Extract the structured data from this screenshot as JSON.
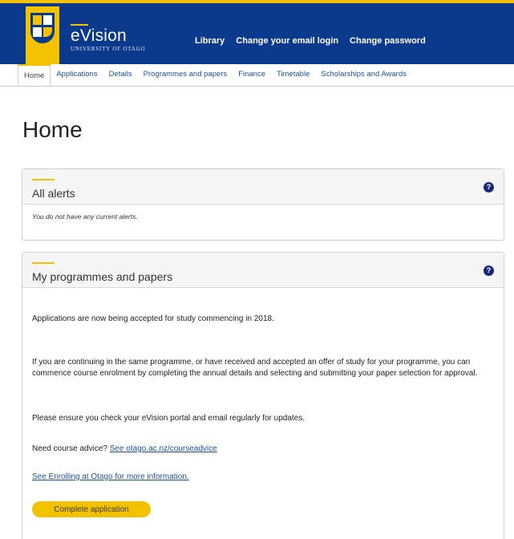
{
  "header": {
    "brand_name": "eVision",
    "brand_sub": "UNIVERSITY OF OTAGO",
    "links": [
      "Library",
      "Change your email login",
      "Change password"
    ]
  },
  "tabs": [
    "Home",
    "Applications",
    "Details",
    "Programmes and papers",
    "Finance",
    "Timetable",
    "Scholarships and Awards"
  ],
  "active_tab": "Home",
  "page_title": "Home",
  "alerts_panel": {
    "title": "All alerts",
    "message": "You do not have any current alerts."
  },
  "programmes_panel": {
    "title": "My programmes and papers",
    "para1": "Applications are now being accepted for study commencing in 2018.",
    "para2": "If you are continuing in the same programme, or have received and accepted an offer of study for your programme, you can commence course enrolment by completing the annual details and selecting and submitting your paper selection for approval.",
    "para3": "Please ensure you check your eVision portal and email regularly for updates.",
    "advice_prefix": "Need course advice? ",
    "advice_link": "See otago.ac.nz/courseadvice",
    "enrolling_link": "See Enrolling at Otago for more information.",
    "button_label": "Complete application"
  },
  "help_icon_glyph": "?",
  "colors": {
    "header_blue": "#0b3a8c",
    "accent_yellow": "#f2c200",
    "link_blue": "#1d4f9e"
  }
}
